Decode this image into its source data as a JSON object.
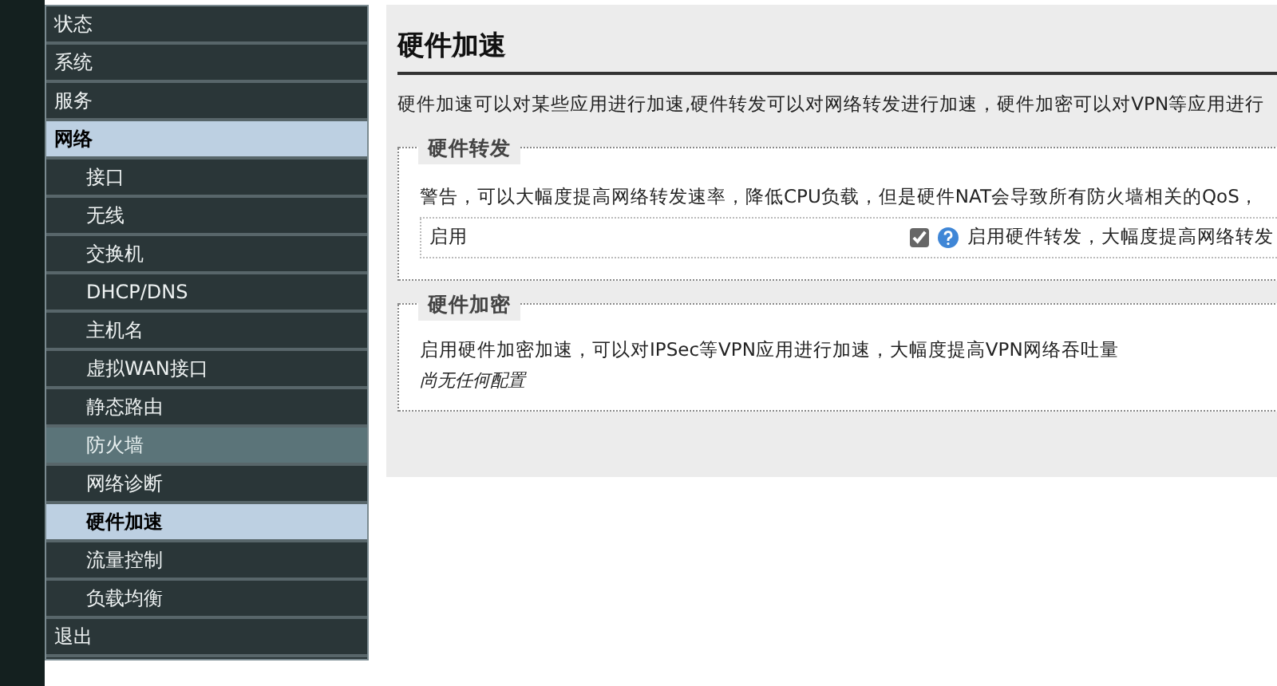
{
  "sidebar": {
    "items": [
      {
        "label": "状态",
        "kind": "top",
        "selected": false,
        "hovered": false
      },
      {
        "label": "系统",
        "kind": "top",
        "selected": false,
        "hovered": false
      },
      {
        "label": "服务",
        "kind": "top",
        "selected": false,
        "hovered": false
      },
      {
        "label": "网络",
        "kind": "top",
        "selected": true,
        "hovered": false
      },
      {
        "label": "接口",
        "kind": "sub",
        "selected": false,
        "hovered": false
      },
      {
        "label": "无线",
        "kind": "sub",
        "selected": false,
        "hovered": false
      },
      {
        "label": "交换机",
        "kind": "sub",
        "selected": false,
        "hovered": false
      },
      {
        "label": "DHCP/DNS",
        "kind": "sub",
        "selected": false,
        "hovered": false
      },
      {
        "label": "主机名",
        "kind": "sub",
        "selected": false,
        "hovered": false
      },
      {
        "label": "虚拟WAN接口",
        "kind": "sub",
        "selected": false,
        "hovered": false
      },
      {
        "label": "静态路由",
        "kind": "sub",
        "selected": false,
        "hovered": false
      },
      {
        "label": "防火墙",
        "kind": "sub",
        "selected": false,
        "hovered": true
      },
      {
        "label": "网络诊断",
        "kind": "sub",
        "selected": false,
        "hovered": false
      },
      {
        "label": "硬件加速",
        "kind": "sub",
        "selected": true,
        "hovered": false
      },
      {
        "label": "流量控制",
        "kind": "sub",
        "selected": false,
        "hovered": false
      },
      {
        "label": "负载均衡",
        "kind": "sub",
        "selected": false,
        "hovered": false
      },
      {
        "label": "退出",
        "kind": "top",
        "selected": false,
        "hovered": false
      }
    ]
  },
  "page": {
    "title": "硬件加速",
    "description": "硬件加速可以对某些应用进行加速,硬件转发可以对网络转发进行加速，硬件加密可以对VPN等应用进行",
    "sections": [
      {
        "legend": "硬件转发",
        "text": "警告，可以大幅度提高网络转发速率，降低CPU负载，但是硬件NAT会导致所有防火墙相关的QoS，",
        "option": {
          "label": "启用",
          "checked": true,
          "help": "启用硬件转发，大幅度提高网络转发"
        }
      },
      {
        "legend": "硬件加密",
        "text": "启用硬件加密加速，可以对IPSec等VPN应用进行加速，大幅度提高VPN网络吞吐量",
        "note": "尚无任何配置"
      }
    ]
  }
}
